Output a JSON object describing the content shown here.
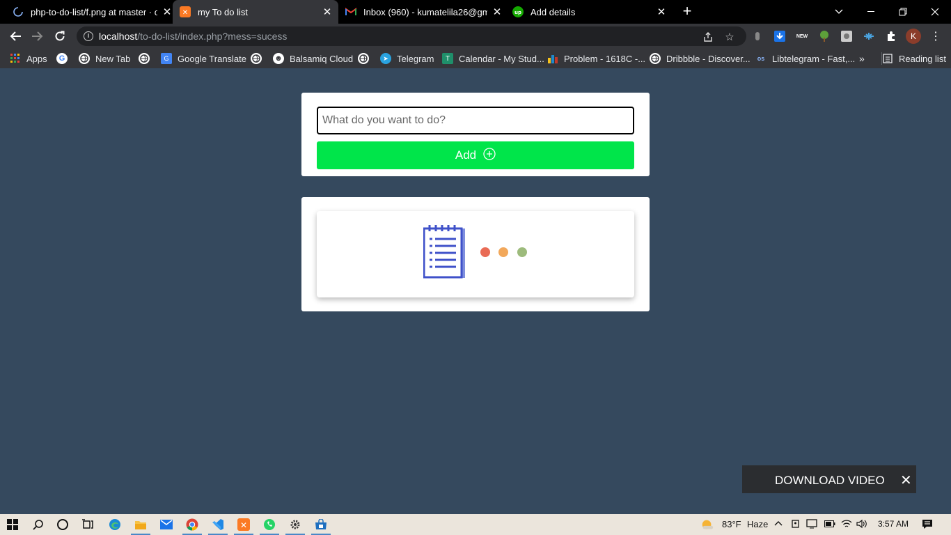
{
  "browser": {
    "tabs": [
      {
        "title": "php-to-do-list/f.png at master · c"
      },
      {
        "title": "my To do list"
      },
      {
        "title": "Inbox (960) - kumatelila26@gmai"
      },
      {
        "title": "Add details"
      }
    ],
    "address": {
      "host": "localhost",
      "path": "/to-do-list/index.php?mess=sucess"
    },
    "avatar_letter": "K"
  },
  "bookmarks": [
    {
      "label": "Apps"
    },
    {
      "label": "New Tab"
    },
    {
      "label": "Google Translate"
    },
    {
      "label": "Balsamiq Cloud"
    },
    {
      "label": "Telegram"
    },
    {
      "label": "Calendar - My Stud..."
    },
    {
      "label": "Problem - 1618C -..."
    },
    {
      "label": "Dribbble - Discover..."
    },
    {
      "label": "Libtelegram - Fast,..."
    },
    {
      "label": "Reading list"
    }
  ],
  "todo": {
    "input_placeholder": "What do you want to do?",
    "input_value": "",
    "add_label": "Add"
  },
  "empty_state": {
    "dot_colors": [
      "#e96b55",
      "#f2a85b",
      "#9dbb7c"
    ]
  },
  "overlay": {
    "download_label": "DOWNLOAD VIDEO"
  },
  "taskbar": {
    "temperature": "83°F",
    "weather": "Haze",
    "time": "3:57 AM"
  },
  "colors": {
    "page_bg": "#35495e",
    "add_button": "#00e54a",
    "notepad": "#3f51c9"
  }
}
